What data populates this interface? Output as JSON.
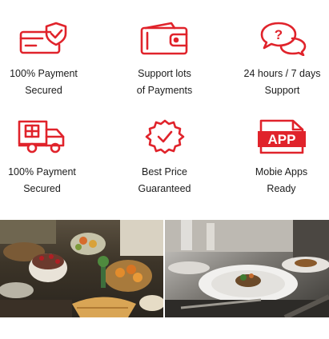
{
  "features": [
    {
      "icon": "secure-card-icon",
      "line1": "100% Payment",
      "line2": "Secured"
    },
    {
      "icon": "wallet-icon",
      "line1": "Support lots",
      "line2": "of Payments"
    },
    {
      "icon": "support-chat-icon",
      "line1": "24 hours / 7 days",
      "line2": "Support"
    },
    {
      "icon": "delivery-truck-icon",
      "line1": "100% Payment",
      "line2": "Secured"
    },
    {
      "icon": "price-badge-icon",
      "line1": "Best Price",
      "line2": "Guaranteed"
    },
    {
      "icon": "app-icon",
      "line1": "Mobie Apps",
      "line2": "Ready"
    }
  ],
  "icons": {
    "color": "#e0232b",
    "app_text": "APP"
  },
  "photos": [
    {
      "subject": "buffet-food-photo"
    },
    {
      "subject": "plated-dish-photo"
    }
  ]
}
